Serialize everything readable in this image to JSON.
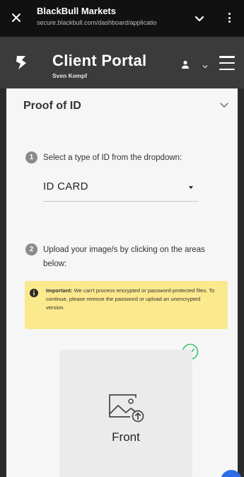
{
  "browser": {
    "title": "BlackBull Markets",
    "url": "secure.blackbull.com/dashboard/applicatio",
    "icons": {
      "close": "close-icon",
      "expand": "chevron-down-icon",
      "menu": "more-vert-icon"
    }
  },
  "header": {
    "title": "Client Portal",
    "user_name": "Sven Kempf",
    "icons": {
      "logo": "blackbull-logo-icon",
      "user": "user-icon",
      "user_menu": "chevron-down-icon",
      "menu": "hamburger-icon"
    }
  },
  "section": {
    "title": "Proof of ID",
    "steps": [
      {
        "number": "1",
        "text": "Select a type of ID from the dropdown:"
      },
      {
        "number": "2",
        "text": "Upload your image/s by clicking on the areas below:"
      }
    ],
    "id_type": {
      "selected": "ID CARD"
    },
    "notice": {
      "strong": "Important:",
      "text": " We can't process encrypted or password-protected files. To continue, please remove the password or upload an unencrypted version."
    },
    "upload": {
      "label": "Front",
      "status_icon": "check-circle-icon"
    }
  },
  "colors": {
    "browser_bar": "#111111",
    "header": "#3b3b3b",
    "panel": "#f6f6f6",
    "notice": "#fbe98d",
    "success": "#3cc46a",
    "step_badge": "#8a8a8a"
  }
}
